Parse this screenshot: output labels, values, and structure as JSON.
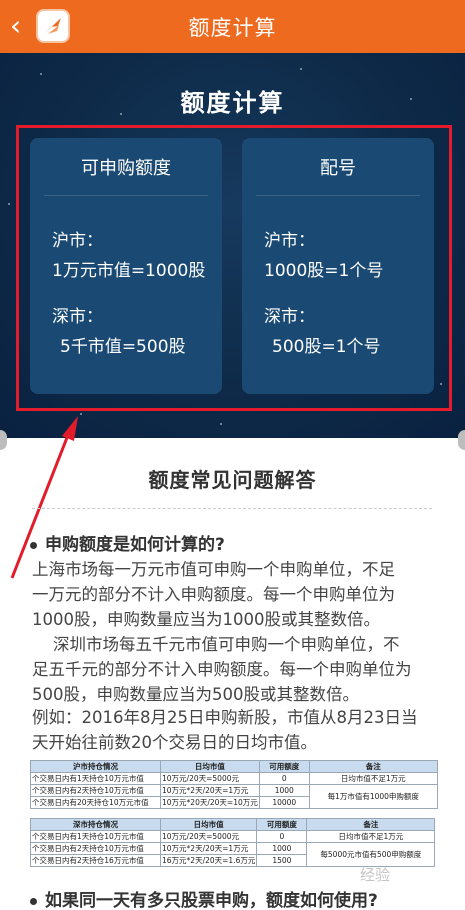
{
  "topbar": {
    "title": "额度计算",
    "back_glyph": "‹"
  },
  "hero": {
    "title": "额度计算",
    "left_card": {
      "head": "可申购额度",
      "lines": [
        "沪市：",
        "1万元市值=1000股",
        "深市：",
        "5千市值=500股"
      ]
    },
    "right_card": {
      "head": "配号",
      "lines": [
        "沪市：",
        "1000股=1个号",
        "深市：",
        "500股=1个号"
      ]
    }
  },
  "faq": {
    "title": "额度常见问题解答",
    "q1": "申购额度是如何计算的?",
    "p1": [
      "上海市场每一万元市值可申购一个申购单位，不足",
      "一万元的部分不计入申购额度。每一个申购单位为",
      "1000股，申购数量应当为1000股或其整数倍。",
      "    深圳市场每五千元市值可申购一个申购单位，不",
      "足五千元的部分不计入申购额度。每一个申购单位为",
      "500股，申购数量应当为500股或其整数倍。"
    ],
    "p2": [
      "例如：2016年8月25日申购新股，市值从8月23日当",
      "天开始往前数20个交易日的日均市值。"
    ],
    "q2": "如果同一天有多只股票申购，额度如何使用?"
  },
  "table_sh": {
    "headers": [
      "沪市持仓情况",
      "日均市值",
      "可用额度",
      "备注"
    ],
    "rows": [
      [
        "个交易日内有1天持仓10万元市值",
        "10万元/20天=5000元",
        "0",
        "日均市值不足1万元"
      ],
      [
        "个交易日内有2天持仓10万元市值",
        "10万元*2天/20天=1万元",
        "1000",
        "每1万市值有1000申购额度"
      ],
      [
        "个交易日内有20天持仓10万元市值",
        "10万元*20天/20天=10万元",
        "10000",
        ""
      ]
    ]
  },
  "table_sz": {
    "headers": [
      "深市持仓情况",
      "日均市值",
      "可用额度",
      "备注"
    ],
    "rows": [
      [
        "个交易日内有1天持仓10万元市值",
        "10万元/20天=5000元",
        "0",
        "日均市值不足1万元"
      ],
      [
        "个交易日内有2天持仓10万元市值",
        "10万元*2天/20天=1万元",
        "1000",
        "每5000元市值有500申购额度"
      ],
      [
        "个交易日内有2天持仓16万元市值",
        "16万元*2天/20天=1.6万元",
        "1500",
        ""
      ]
    ]
  },
  "watermark": "经验",
  "colors": {
    "topbar": "#ee6a1f",
    "hero_bg": "#0e2a48",
    "card": "#1a4a73",
    "annotation": "#e21c2a"
  }
}
